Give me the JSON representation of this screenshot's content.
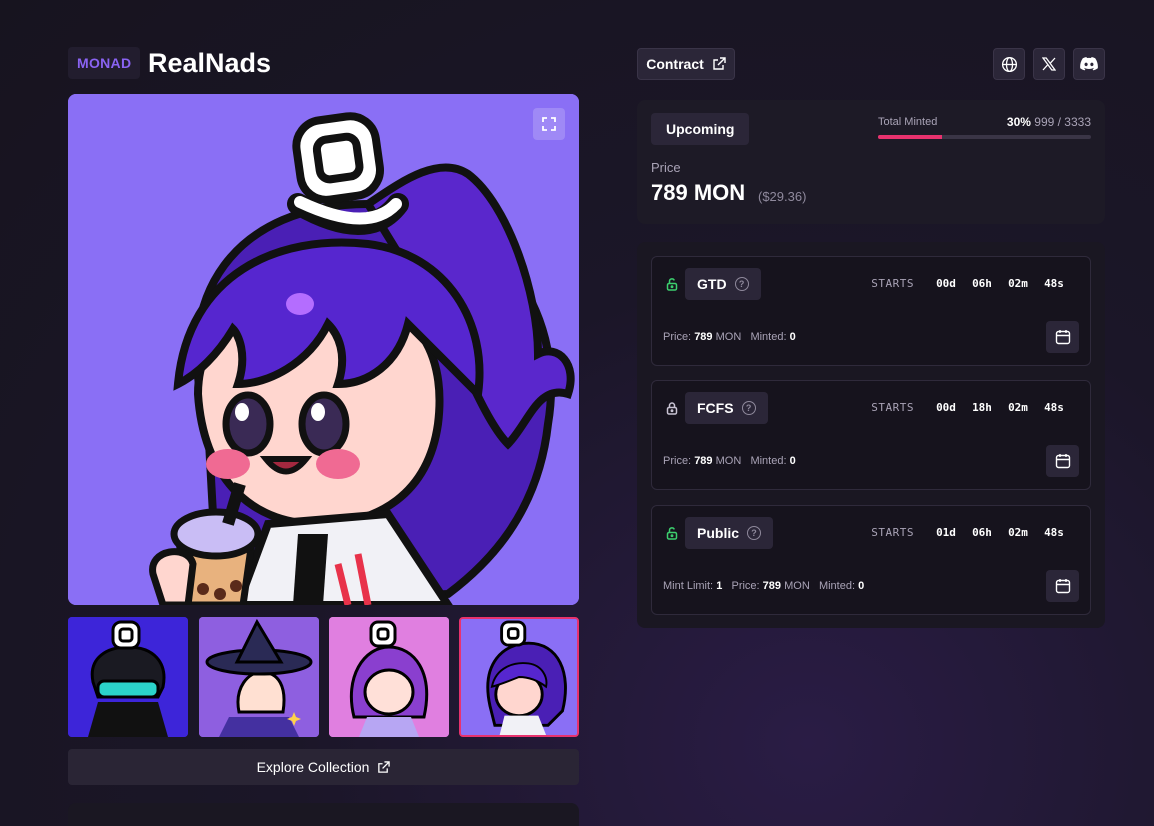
{
  "header": {
    "chain_badge": "MONAD",
    "collection_title": "RealNads",
    "contract_label": "Contract"
  },
  "status": {
    "state_label": "Upcoming",
    "total_minted_label": "Total Minted",
    "minted_percent_text": "30%",
    "minted_count_text": "999 / 3333",
    "minted_fraction": 0.3,
    "price_label": "Price",
    "price_value": "789 MON",
    "price_usd": "($29.36)"
  },
  "phases": [
    {
      "name": "GTD",
      "unlocked": true,
      "starts_label": "STARTS",
      "countdown": [
        "00d",
        "06h",
        "02m",
        "48s"
      ],
      "meta": [
        {
          "label": "Price:",
          "value": "789",
          "suffix": "MON"
        },
        {
          "label": "Minted:",
          "value": "0",
          "suffix": ""
        }
      ]
    },
    {
      "name": "FCFS",
      "unlocked": false,
      "starts_label": "STARTS",
      "countdown": [
        "00d",
        "18h",
        "02m",
        "48s"
      ],
      "meta": [
        {
          "label": "Price:",
          "value": "789",
          "suffix": "MON"
        },
        {
          "label": "Minted:",
          "value": "0",
          "suffix": ""
        }
      ]
    },
    {
      "name": "Public",
      "unlocked": true,
      "starts_label": "STARTS",
      "countdown": [
        "01d",
        "06h",
        "02m",
        "48s"
      ],
      "meta": [
        {
          "label": "Mint Limit:",
          "value": "1",
          "suffix": ""
        },
        {
          "label": "Price:",
          "value": "789",
          "suffix": "MON"
        },
        {
          "label": "Minted:",
          "value": "0",
          "suffix": ""
        }
      ]
    }
  ],
  "gallery": {
    "explore_label": "Explore Collection",
    "thumb_icons": [
      "nad-visor-thumb",
      "nad-wizard-thumb",
      "nad-pink-thumb",
      "nad-boba-thumb"
    ],
    "selected_index": 3
  },
  "colors": {
    "accent": "#e8326e",
    "brand": "#8a63f2",
    "unlocked": "#3ccf6e",
    "locked": "#c9c4d4"
  }
}
